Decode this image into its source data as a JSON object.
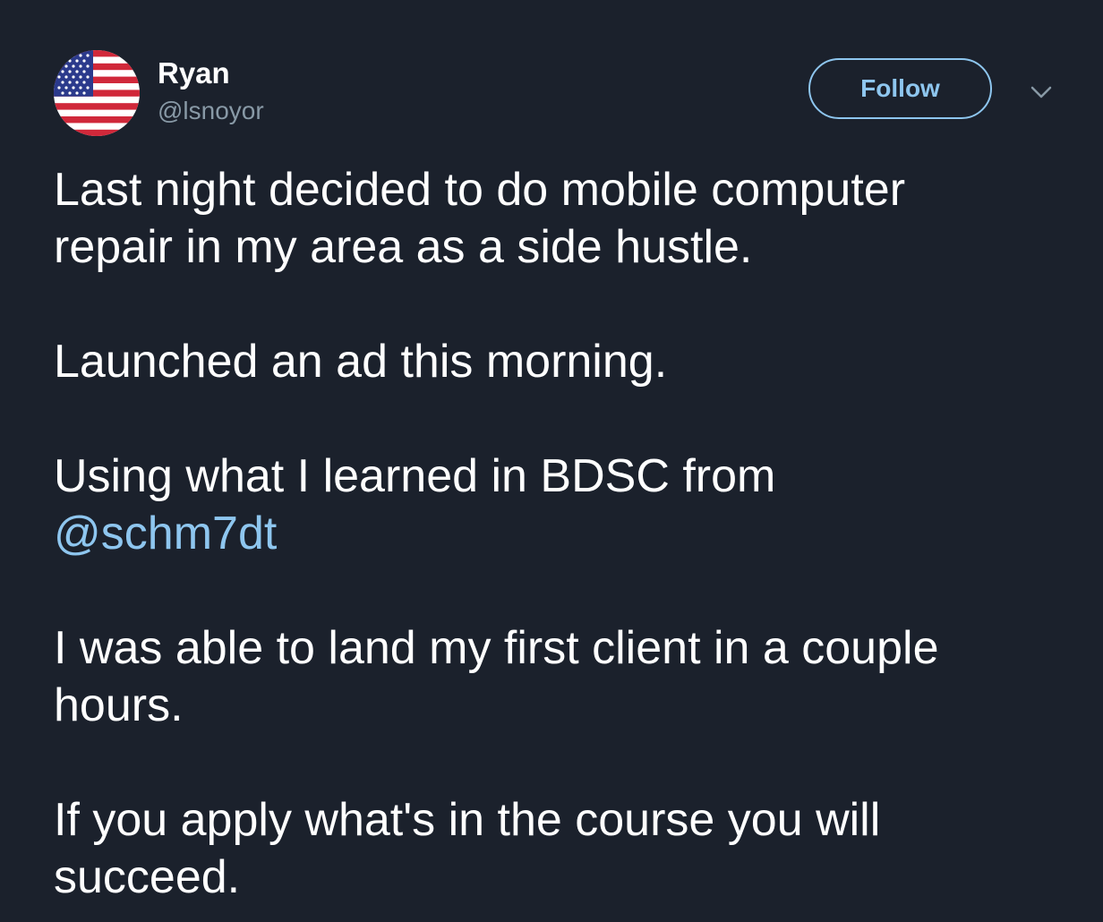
{
  "user": {
    "name": "Ryan",
    "handle": "@lsnoyor",
    "avatar_icon": "us-flag-icon"
  },
  "actions": {
    "follow_label": "Follow",
    "menu_icon": "chevron-down-icon"
  },
  "tweet": {
    "paragraph_1_line_1": "Last night decided to do mobile computer",
    "paragraph_1_line_2": "repair in my area as a side hustle.",
    "paragraph_2": "Launched an ad this morning.",
    "paragraph_3_text": "Using what I learned in BDSC from",
    "paragraph_3_mention": "@schm7dt",
    "paragraph_4_line_1": "I was able to land my first client in a couple",
    "paragraph_4_line_2": "hours.",
    "paragraph_5_line_1": "If you apply what's in the course you will",
    "paragraph_5_line_2": "succeed."
  },
  "colors": {
    "background": "#1b212c",
    "accent": "#8ec6ef",
    "secondary_text": "#8899a6"
  }
}
